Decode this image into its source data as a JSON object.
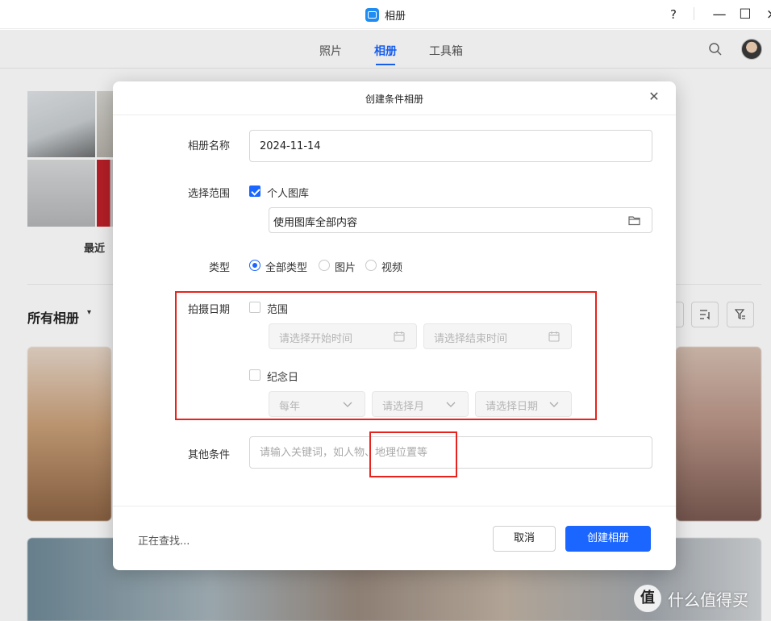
{
  "window": {
    "title": "相册",
    "help": "?",
    "minimize": "—",
    "maximize": "☐",
    "close": "×"
  },
  "nav": {
    "tabs": [
      "照片",
      "相册",
      "工具箱"
    ],
    "active_tab": "相册"
  },
  "page": {
    "recent_label": "最近",
    "all_albums_label": "所有相册",
    "all_albums_caret": "▾"
  },
  "dialog": {
    "title": "创建条件相册",
    "name_label": "相册名称",
    "name_value": "2024-11-14",
    "scope_label": "选择范围",
    "personal_library_label": "个人图库",
    "personal_library_checked": true,
    "scope_value": "使用图库全部内容",
    "type_label": "类型",
    "type_options": [
      "全部类型",
      "图片",
      "视频"
    ],
    "type_selected": "全部类型",
    "date_label": "拍摄日期",
    "range_label": "范围",
    "start_date_placeholder": "请选择开始时间",
    "end_date_placeholder": "请选择结束时间",
    "anniversary_label": "纪念日",
    "year_value": "每年",
    "month_placeholder": "请选择月",
    "day_placeholder": "请选择日期",
    "other_label": "其他条件",
    "other_placeholder": "请输入关键词，如人物、地理位置等",
    "status_text": "正在查找...",
    "cancel_label": "取消",
    "create_label": "创建相册"
  },
  "colors": {
    "accent": "#1a66ff",
    "annotation": "#e8231d"
  },
  "watermark": {
    "logo": "值",
    "text": "什么值得买"
  }
}
